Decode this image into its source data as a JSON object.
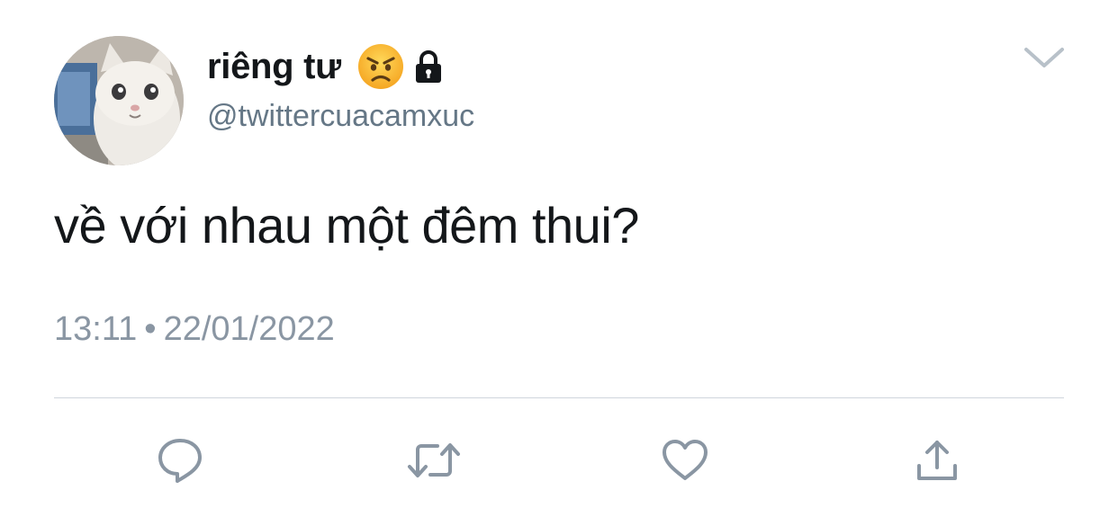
{
  "tweet": {
    "display_name": "riêng tư",
    "handle": "@twittercuacamxuc",
    "text": "về với nhau một đêm thui?",
    "time": "13:11",
    "separator": "•",
    "date": "22/01/2022"
  },
  "icons": {
    "name_emoji": "angry-face-icon",
    "protected": "lock-icon",
    "menu": "chevron-down-icon",
    "actions": [
      "reply-icon",
      "retweet-icon",
      "like-icon",
      "share-icon"
    ]
  },
  "colors": {
    "text_primary": "#14171a",
    "text_secondary": "#657786",
    "icon_gray": "#8a96a3",
    "divider": "#cfd6dc"
  }
}
